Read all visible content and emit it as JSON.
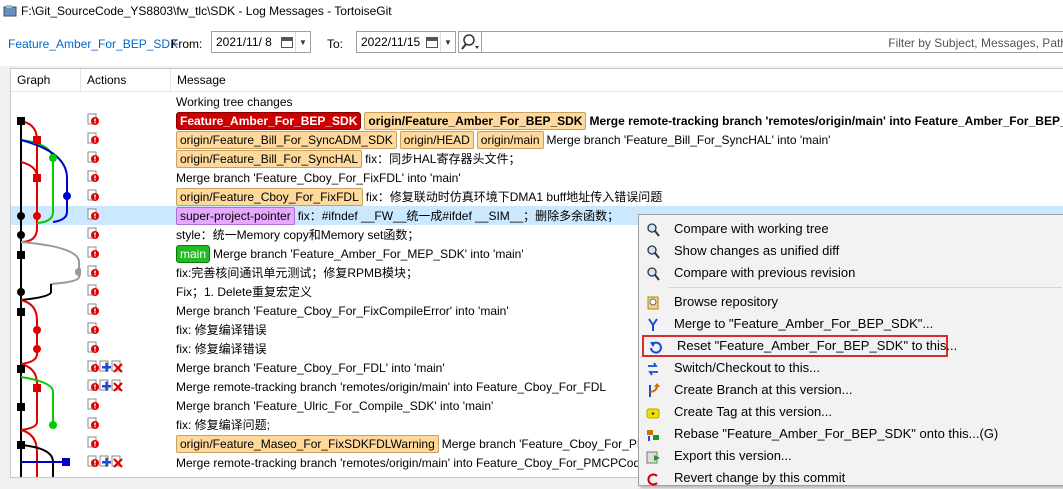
{
  "window": {
    "title": "F:\\Git_SourceCode_YS8803\\fw_tlc\\SDK - Log Messages - TortoiseGit"
  },
  "filter": {
    "branch": "Feature_Amber_For_BEP_SDK",
    "from_label": "From:",
    "from_date": "2021/11/  8",
    "to_label": "To:",
    "to_date": "2022/11/15",
    "search_placeholder": "Filter by Subject, Messages, Path"
  },
  "columns": {
    "graph": "Graph",
    "actions": "Actions",
    "message": "Message"
  },
  "rows": [
    {
      "text": "Working tree changes",
      "tags": []
    },
    {
      "tags": [
        {
          "label": "Feature_Amber_For_BEP_SDK",
          "kind": "head"
        },
        {
          "label": "origin/Feature_Amber_For_BEP_SDK",
          "kind": "remote-bold"
        }
      ],
      "text": "Merge remote-tracking branch 'remotes/origin/main' into Feature_Amber_For_BEP_SDK"
    },
    {
      "tags": [
        {
          "label": "origin/Feature_Bill_For_SyncADM_SDK",
          "kind": "remote"
        },
        {
          "label": "origin/HEAD",
          "kind": "remote"
        },
        {
          "label": "origin/main",
          "kind": "remote"
        }
      ],
      "text": "Merge branch 'Feature_Bill_For_SyncHAL' into 'main'"
    },
    {
      "tags": [
        {
          "label": "origin/Feature_Bill_For_SyncHAL",
          "kind": "remote"
        }
      ],
      "text": "fix：同步HAL寄存器头文件；"
    },
    {
      "tags": [],
      "text": "Merge branch 'Feature_Cboy_For_FixFDL' into 'main'"
    },
    {
      "tags": [
        {
          "label": "origin/Feature_Cboy_For_FixFDL",
          "kind": "remote"
        }
      ],
      "text": "fix：修复联动时仿真环境下DMA1 buff地址传入错误问题"
    },
    {
      "tags": [
        {
          "label": "super-project-pointer",
          "kind": "super"
        }
      ],
      "text": "fix：#ifndef  __FW__统一成#ifdef __SIM__；删除多余函数；"
    },
    {
      "tags": [],
      "text": "style：统一Memory copy和Memory set函数；"
    },
    {
      "tags": [
        {
          "label": "main",
          "kind": "main"
        }
      ],
      "text": "Merge branch 'Feature_Amber_For_MEP_SDK' into 'main'"
    },
    {
      "tags": [],
      "text": "fix:完善核间通讯单元测试；修复RPMB模块；"
    },
    {
      "tags": [],
      "text": "Fix；1. Delete重复宏定义"
    },
    {
      "tags": [],
      "text": "Merge branch 'Feature_Cboy_For_FixCompileError' into 'main'"
    },
    {
      "tags": [],
      "text": "fix: 修复编译错误"
    },
    {
      "tags": [],
      "text": "fix: 修复编译错误"
    },
    {
      "tags": [],
      "text": "Merge branch 'Feature_Cboy_For_FDL' into 'main'"
    },
    {
      "tags": [],
      "text": "Merge remote-tracking branch 'remotes/origin/main' into Feature_Cboy_For_FDL"
    },
    {
      "tags": [],
      "text": "Merge branch 'Feature_Ulric_For_Compile_SDK' into 'main'"
    },
    {
      "tags": [],
      "text": "fix: 修复编译问题;"
    },
    {
      "tags": [
        {
          "label": "origin/Feature_Maseo_For_FixSDKFDLWarning",
          "kind": "remote"
        }
      ],
      "text": "Merge branch 'Feature_Cboy_For_PMCPCode' into 'main'"
    },
    {
      "tags": [],
      "text": "Merge remote-tracking branch 'remotes/origin/main' into Feature_Cboy_For_PMCPCode"
    }
  ],
  "context_menu": {
    "items": [
      {
        "label": "Compare with working tree",
        "icon": "magnifier-icon"
      },
      {
        "label": "Show changes as unified diff",
        "icon": "magnifier-icon"
      },
      {
        "label": "Compare with previous revision",
        "icon": "magnifier-icon"
      },
      {
        "label": "Browse repository",
        "icon": "browse-icon"
      },
      {
        "label": "Merge to \"Feature_Amber_For_BEP_SDK\"...",
        "icon": "merge-icon"
      },
      {
        "label": "Reset \"Feature_Amber_For_BEP_SDK\" to this...",
        "icon": "reset-icon"
      },
      {
        "label": "Switch/Checkout to this...",
        "icon": "switch-icon"
      },
      {
        "label": "Create Branch at this version...",
        "icon": "branch-icon"
      },
      {
        "label": "Create Tag at this version...",
        "icon": "tag-icon"
      },
      {
        "label": "Rebase \"Feature_Amber_For_BEP_SDK\" onto this...(G)",
        "icon": "rebase-icon"
      },
      {
        "label": "Export this version...",
        "icon": "export-icon"
      },
      {
        "label": "Revert change by this commit",
        "icon": "revert-icon"
      }
    ]
  }
}
